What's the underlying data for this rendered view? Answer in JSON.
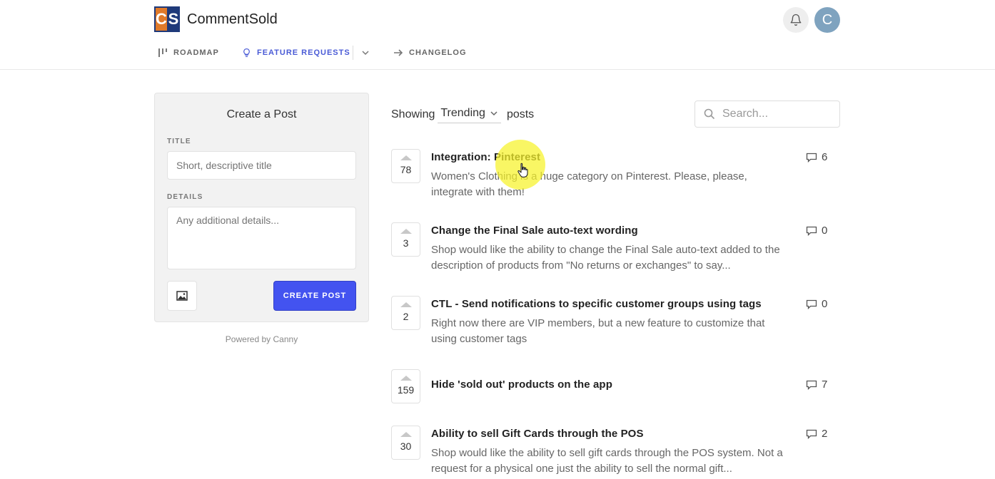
{
  "header": {
    "logo_left": "C",
    "logo_right": "S",
    "brand": "CommentSold",
    "avatar_letter": "C"
  },
  "nav": {
    "roadmap": "ROADMAP",
    "feature_requests": "FEATURE REQUESTS",
    "changelog": "CHANGELOG"
  },
  "create_post": {
    "heading": "Create a Post",
    "title_label": "TITLE",
    "title_placeholder": "Short, descriptive title",
    "details_label": "DETAILS",
    "details_placeholder": "Any additional details...",
    "submit_label": "CREATE POST",
    "powered_by": "Powered by Canny"
  },
  "filter": {
    "showing": "Showing",
    "sort": "Trending",
    "posts": "posts",
    "search_placeholder": "Search..."
  },
  "posts": [
    {
      "votes": "78",
      "title": "Integration: Pinterest",
      "body": "Women's Clothing is a huge category on Pinterest. Please, please, integrate with them!",
      "comments": "6"
    },
    {
      "votes": "3",
      "title": "Change the Final Sale auto-text wording",
      "body": "Shop would like the ability to change the Final Sale auto-text added to the description of products from \"No returns or exchanges\" to say...",
      "comments": "0"
    },
    {
      "votes": "2",
      "title": "CTL - Send notifications to specific customer groups using tags",
      "body": "Right now there are VIP members, but a new feature to customize that using customer tags",
      "comments": "0"
    },
    {
      "votes": "159",
      "title": "Hide 'sold out' products on the app",
      "body": "",
      "comments": "7"
    },
    {
      "votes": "30",
      "title": "Ability to sell Gift Cards through the POS",
      "body": "Shop would like the ability to sell gift cards through the POS system. Not a request for a physical one just the ability to sell the normal gift...",
      "comments": "2"
    }
  ],
  "colors": {
    "accent": "#4353f0",
    "nav_active": "#4a5bd6",
    "cursor_highlight": "#f6f228"
  }
}
